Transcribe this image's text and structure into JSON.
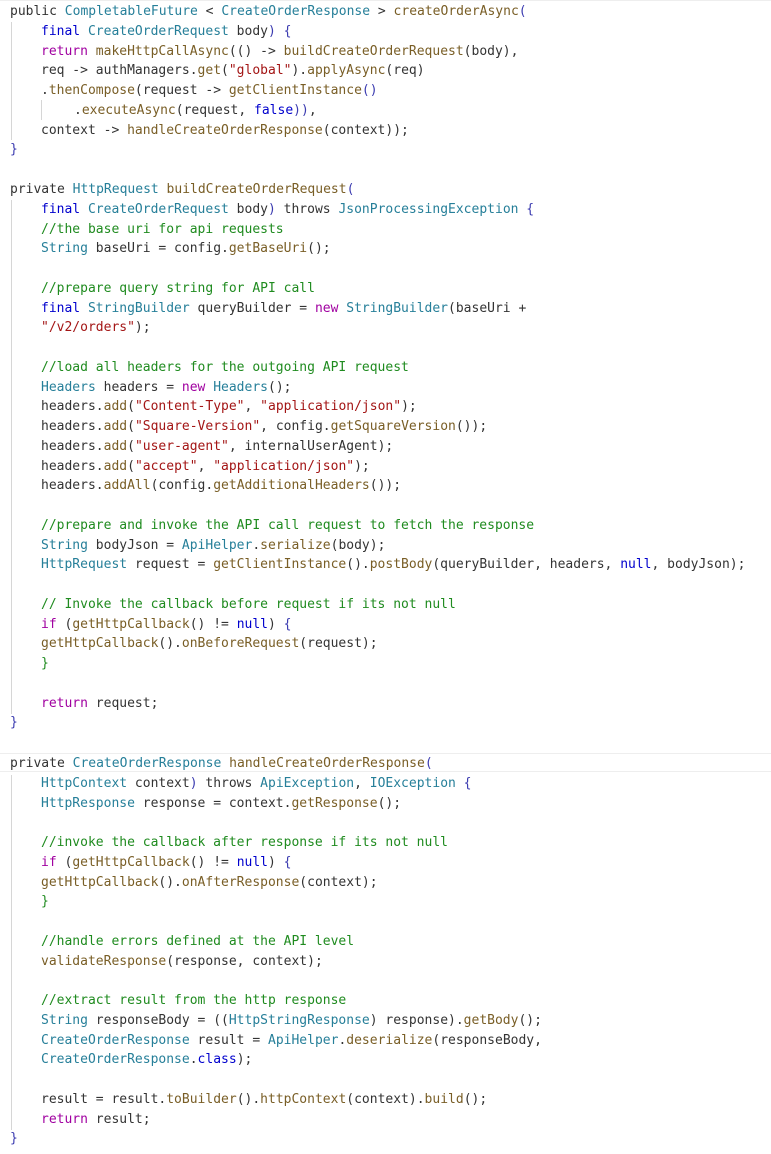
{
  "editor": {
    "language": "java",
    "methods": [
      {
        "name": "createOrderAsync",
        "lines": [
          [
            [
              "plain",
              "public "
            ],
            [
              "ty",
              "CompletableFuture"
            ],
            [
              "plain",
              " < "
            ],
            [
              "ty",
              "CreateOrderResponse"
            ],
            [
              "plain",
              " > "
            ],
            [
              "fn",
              "createOrderAsync"
            ],
            [
              "br",
              "("
            ]
          ],
          [
            [
              "kw",
              "final "
            ],
            [
              "ty",
              "CreateOrderRequest"
            ],
            [
              "plain",
              " body"
            ],
            [
              "br",
              ")"
            ],
            [
              "plain",
              " "
            ],
            [
              "br",
              "{"
            ]
          ],
          [
            [
              "ctl",
              "return "
            ],
            [
              "fn",
              "makeHttpCallAsync"
            ],
            [
              "plain",
              "(() -> "
            ],
            [
              "fn",
              "buildCreateOrderRequest"
            ],
            [
              "plain",
              "(body),"
            ]
          ],
          [
            [
              "plain",
              "req -> authManagers."
            ],
            [
              "fn",
              "get"
            ],
            [
              "plain",
              "("
            ],
            [
              "str",
              "\"global\""
            ],
            [
              "plain",
              ")."
            ],
            [
              "fn",
              "applyAsync"
            ],
            [
              "plain",
              "(req)"
            ]
          ],
          [
            [
              "plain",
              "."
            ],
            [
              "fn",
              "thenCompose"
            ],
            [
              "plain",
              "(request -> "
            ],
            [
              "fn",
              "getClientInstance"
            ],
            [
              "br",
              "()"
            ]
          ],
          [
            [
              "plain",
              "."
            ],
            [
              "fn",
              "executeAsync"
            ],
            [
              "plain",
              "(request, "
            ],
            [
              "kw",
              "false"
            ],
            [
              "br",
              "))"
            ],
            [
              "plain",
              ","
            ]
          ],
          [
            [
              "plain",
              "context -> "
            ],
            [
              "fn",
              "handleCreateOrderResponse"
            ],
            [
              "plain",
              "(context));"
            ]
          ],
          [
            [
              "br",
              "}"
            ]
          ]
        ]
      },
      {
        "name": "buildCreateOrderRequest",
        "lines": [
          [
            [
              "plain",
              "private "
            ],
            [
              "ty",
              "HttpRequest"
            ],
            [
              "plain",
              " "
            ],
            [
              "fn",
              "buildCreateOrderRequest"
            ],
            [
              "br",
              "("
            ]
          ],
          [
            [
              "kw",
              "final "
            ],
            [
              "ty",
              "CreateOrderRequest"
            ],
            [
              "plain",
              " body"
            ],
            [
              "br",
              ")"
            ],
            [
              "plain",
              " throws "
            ],
            [
              "ty",
              "JsonProcessingException"
            ],
            [
              "plain",
              " "
            ],
            [
              "br",
              "{"
            ]
          ],
          [
            [
              "cm",
              "//the base uri for api requests"
            ]
          ],
          [
            [
              "ty",
              "String"
            ],
            [
              "plain",
              " baseUri = config."
            ],
            [
              "fn",
              "getBaseUri"
            ],
            [
              "plain",
              "();"
            ]
          ],
          [],
          [
            [
              "cm",
              "//prepare query string for API call"
            ]
          ],
          [
            [
              "kw",
              "final "
            ],
            [
              "ty",
              "StringBuilder"
            ],
            [
              "plain",
              " queryBuilder = "
            ],
            [
              "ctl",
              "new "
            ],
            [
              "ty",
              "StringBuilder"
            ],
            [
              "plain",
              "(baseUri +"
            ]
          ],
          [
            [
              "str",
              "\"/v2/orders\""
            ],
            [
              "plain",
              ");"
            ]
          ],
          [],
          [
            [
              "cm",
              "//load all headers for the outgoing API request"
            ]
          ],
          [
            [
              "ty",
              "Headers"
            ],
            [
              "plain",
              " headers = "
            ],
            [
              "ctl",
              "new "
            ],
            [
              "ty",
              "Headers"
            ],
            [
              "plain",
              "();"
            ]
          ],
          [
            [
              "plain",
              "headers."
            ],
            [
              "fn",
              "add"
            ],
            [
              "plain",
              "("
            ],
            [
              "str",
              "\"Content-Type\""
            ],
            [
              "plain",
              ", "
            ],
            [
              "str",
              "\"application/json\""
            ],
            [
              "plain",
              ");"
            ]
          ],
          [
            [
              "plain",
              "headers."
            ],
            [
              "fn",
              "add"
            ],
            [
              "plain",
              "("
            ],
            [
              "str",
              "\"Square-Version\""
            ],
            [
              "plain",
              ", config."
            ],
            [
              "fn",
              "getSquareVersion"
            ],
            [
              "plain",
              "());"
            ]
          ],
          [
            [
              "plain",
              "headers."
            ],
            [
              "fn",
              "add"
            ],
            [
              "plain",
              "("
            ],
            [
              "str",
              "\"user-agent\""
            ],
            [
              "plain",
              ", internalUserAgent);"
            ]
          ],
          [
            [
              "plain",
              "headers."
            ],
            [
              "fn",
              "add"
            ],
            [
              "plain",
              "("
            ],
            [
              "str",
              "\"accept\""
            ],
            [
              "plain",
              ", "
            ],
            [
              "str",
              "\"application/json\""
            ],
            [
              "plain",
              ");"
            ]
          ],
          [
            [
              "plain",
              "headers."
            ],
            [
              "fn",
              "addAll"
            ],
            [
              "plain",
              "(config."
            ],
            [
              "fn",
              "getAdditionalHeaders"
            ],
            [
              "plain",
              "());"
            ]
          ],
          [],
          [
            [
              "cm",
              "//prepare and invoke the API call request to fetch the response"
            ]
          ],
          [
            [
              "ty",
              "String"
            ],
            [
              "plain",
              " bodyJson = "
            ],
            [
              "ty",
              "ApiHelper"
            ],
            [
              "plain",
              "."
            ],
            [
              "fn",
              "serialize"
            ],
            [
              "plain",
              "(body);"
            ]
          ],
          [
            [
              "ty",
              "HttpRequest"
            ],
            [
              "plain",
              " request = "
            ],
            [
              "fn",
              "getClientInstance"
            ],
            [
              "plain",
              "()."
            ],
            [
              "fn",
              "postBody"
            ],
            [
              "plain",
              "(queryBuilder, headers, "
            ],
            [
              "kw",
              "null"
            ],
            [
              "plain",
              ", bodyJson);"
            ]
          ],
          [],
          [
            [
              "cm",
              "// Invoke the callback before request if its not null"
            ]
          ],
          [
            [
              "ctl",
              "if "
            ],
            [
              "plain",
              "("
            ],
            [
              "fn",
              "getHttpCallback"
            ],
            [
              "plain",
              "() != "
            ],
            [
              "kw",
              "null"
            ],
            [
              "plain",
              ") "
            ],
            [
              "br",
              "{"
            ]
          ],
          [
            [
              "fn",
              "getHttpCallback"
            ],
            [
              "plain",
              "()."
            ],
            [
              "fn",
              "onBeforeRequest"
            ],
            [
              "plain",
              "(request);"
            ]
          ],
          [
            [
              "cm",
              "}"
            ]
          ],
          [],
          [
            [
              "ctl",
              "return "
            ],
            [
              "plain",
              "request;"
            ]
          ],
          [
            [
              "br",
              "}"
            ]
          ]
        ]
      },
      {
        "name": "handleCreateOrderResponse",
        "lines": [
          [
            [
              "plain",
              "private "
            ],
            [
              "ty",
              "CreateOrderResponse"
            ],
            [
              "plain",
              " "
            ],
            [
              "fn",
              "handleCreateOrderResponse"
            ],
            [
              "br",
              "("
            ]
          ],
          [
            [
              "ty",
              "HttpContext"
            ],
            [
              "plain",
              " context"
            ],
            [
              "br",
              ")"
            ],
            [
              "plain",
              " throws "
            ],
            [
              "ty",
              "ApiException"
            ],
            [
              "plain",
              ", "
            ],
            [
              "ty",
              "IOException"
            ],
            [
              "plain",
              " "
            ],
            [
              "br",
              "{"
            ]
          ],
          [
            [
              "ty",
              "HttpResponse"
            ],
            [
              "plain",
              " response = context."
            ],
            [
              "fn",
              "getResponse"
            ],
            [
              "plain",
              "();"
            ]
          ],
          [],
          [
            [
              "cm",
              "//invoke the callback after response if its not null"
            ]
          ],
          [
            [
              "ctl",
              "if "
            ],
            [
              "plain",
              "("
            ],
            [
              "fn",
              "getHttpCallback"
            ],
            [
              "plain",
              "() != "
            ],
            [
              "kw",
              "null"
            ],
            [
              "plain",
              ") "
            ],
            [
              "br",
              "{"
            ]
          ],
          [
            [
              "fn",
              "getHttpCallback"
            ],
            [
              "plain",
              "()."
            ],
            [
              "fn",
              "onAfterResponse"
            ],
            [
              "plain",
              "(context);"
            ]
          ],
          [
            [
              "cm",
              "}"
            ]
          ],
          [],
          [
            [
              "cm",
              "//handle errors defined at the API level"
            ]
          ],
          [
            [
              "fn",
              "validateResponse"
            ],
            [
              "plain",
              "(response, context);"
            ]
          ],
          [],
          [
            [
              "cm",
              "//extract result from the http response"
            ]
          ],
          [
            [
              "ty",
              "String"
            ],
            [
              "plain",
              " responseBody = (("
            ],
            [
              "ty",
              "HttpStringResponse"
            ],
            [
              "plain",
              ") response)."
            ],
            [
              "fn",
              "getBody"
            ],
            [
              "plain",
              "();"
            ]
          ],
          [
            [
              "ty",
              "CreateOrderResponse"
            ],
            [
              "plain",
              " result = "
            ],
            [
              "ty",
              "ApiHelper"
            ],
            [
              "plain",
              "."
            ],
            [
              "fn",
              "deserialize"
            ],
            [
              "plain",
              "(responseBody,"
            ]
          ],
          [
            [
              "ty",
              "CreateOrderResponse"
            ],
            [
              "plain",
              "."
            ],
            [
              "kw",
              "class"
            ],
            [
              "plain",
              ");"
            ]
          ],
          [],
          [
            [
              "plain",
              "result = result."
            ],
            [
              "fn",
              "toBuilder"
            ],
            [
              "plain",
              "()."
            ],
            [
              "fn",
              "httpContext"
            ],
            [
              "plain",
              "(context)."
            ],
            [
              "fn",
              "build"
            ],
            [
              "plain",
              "();"
            ]
          ],
          [
            [
              "ctl",
              "return "
            ],
            [
              "plain",
              "result;"
            ]
          ],
          [
            [
              "br",
              "}"
            ]
          ]
        ]
      }
    ]
  }
}
